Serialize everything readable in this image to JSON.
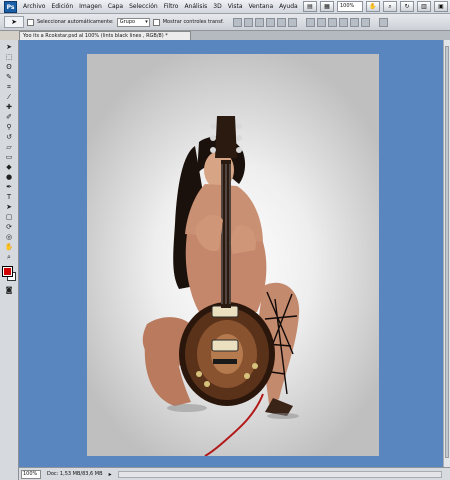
{
  "menubar": {
    "logo": "Ps",
    "items": [
      "Archivo",
      "Edición",
      "Imagen",
      "Capa",
      "Selección",
      "Filtro",
      "Análisis",
      "3D",
      "Vista",
      "Ventana",
      "Ayuda"
    ],
    "zoom": "100%"
  },
  "options": {
    "auto_select_label": "Seleccionar automáticamente:",
    "group_value": "Grupo",
    "show_transform_label": "Mostrar controles transf."
  },
  "document": {
    "tab_title": "Yoo its a Rcokstar.psd al 100% (lints black lines , RGB/8) *"
  },
  "statusbar": {
    "zoom": "100%",
    "doc_info": "Doc: 1,53 MB/83,6 MB"
  },
  "colors": {
    "foreground": "#d10000",
    "background": "#ffffff",
    "workspace": "#5a86c0"
  }
}
